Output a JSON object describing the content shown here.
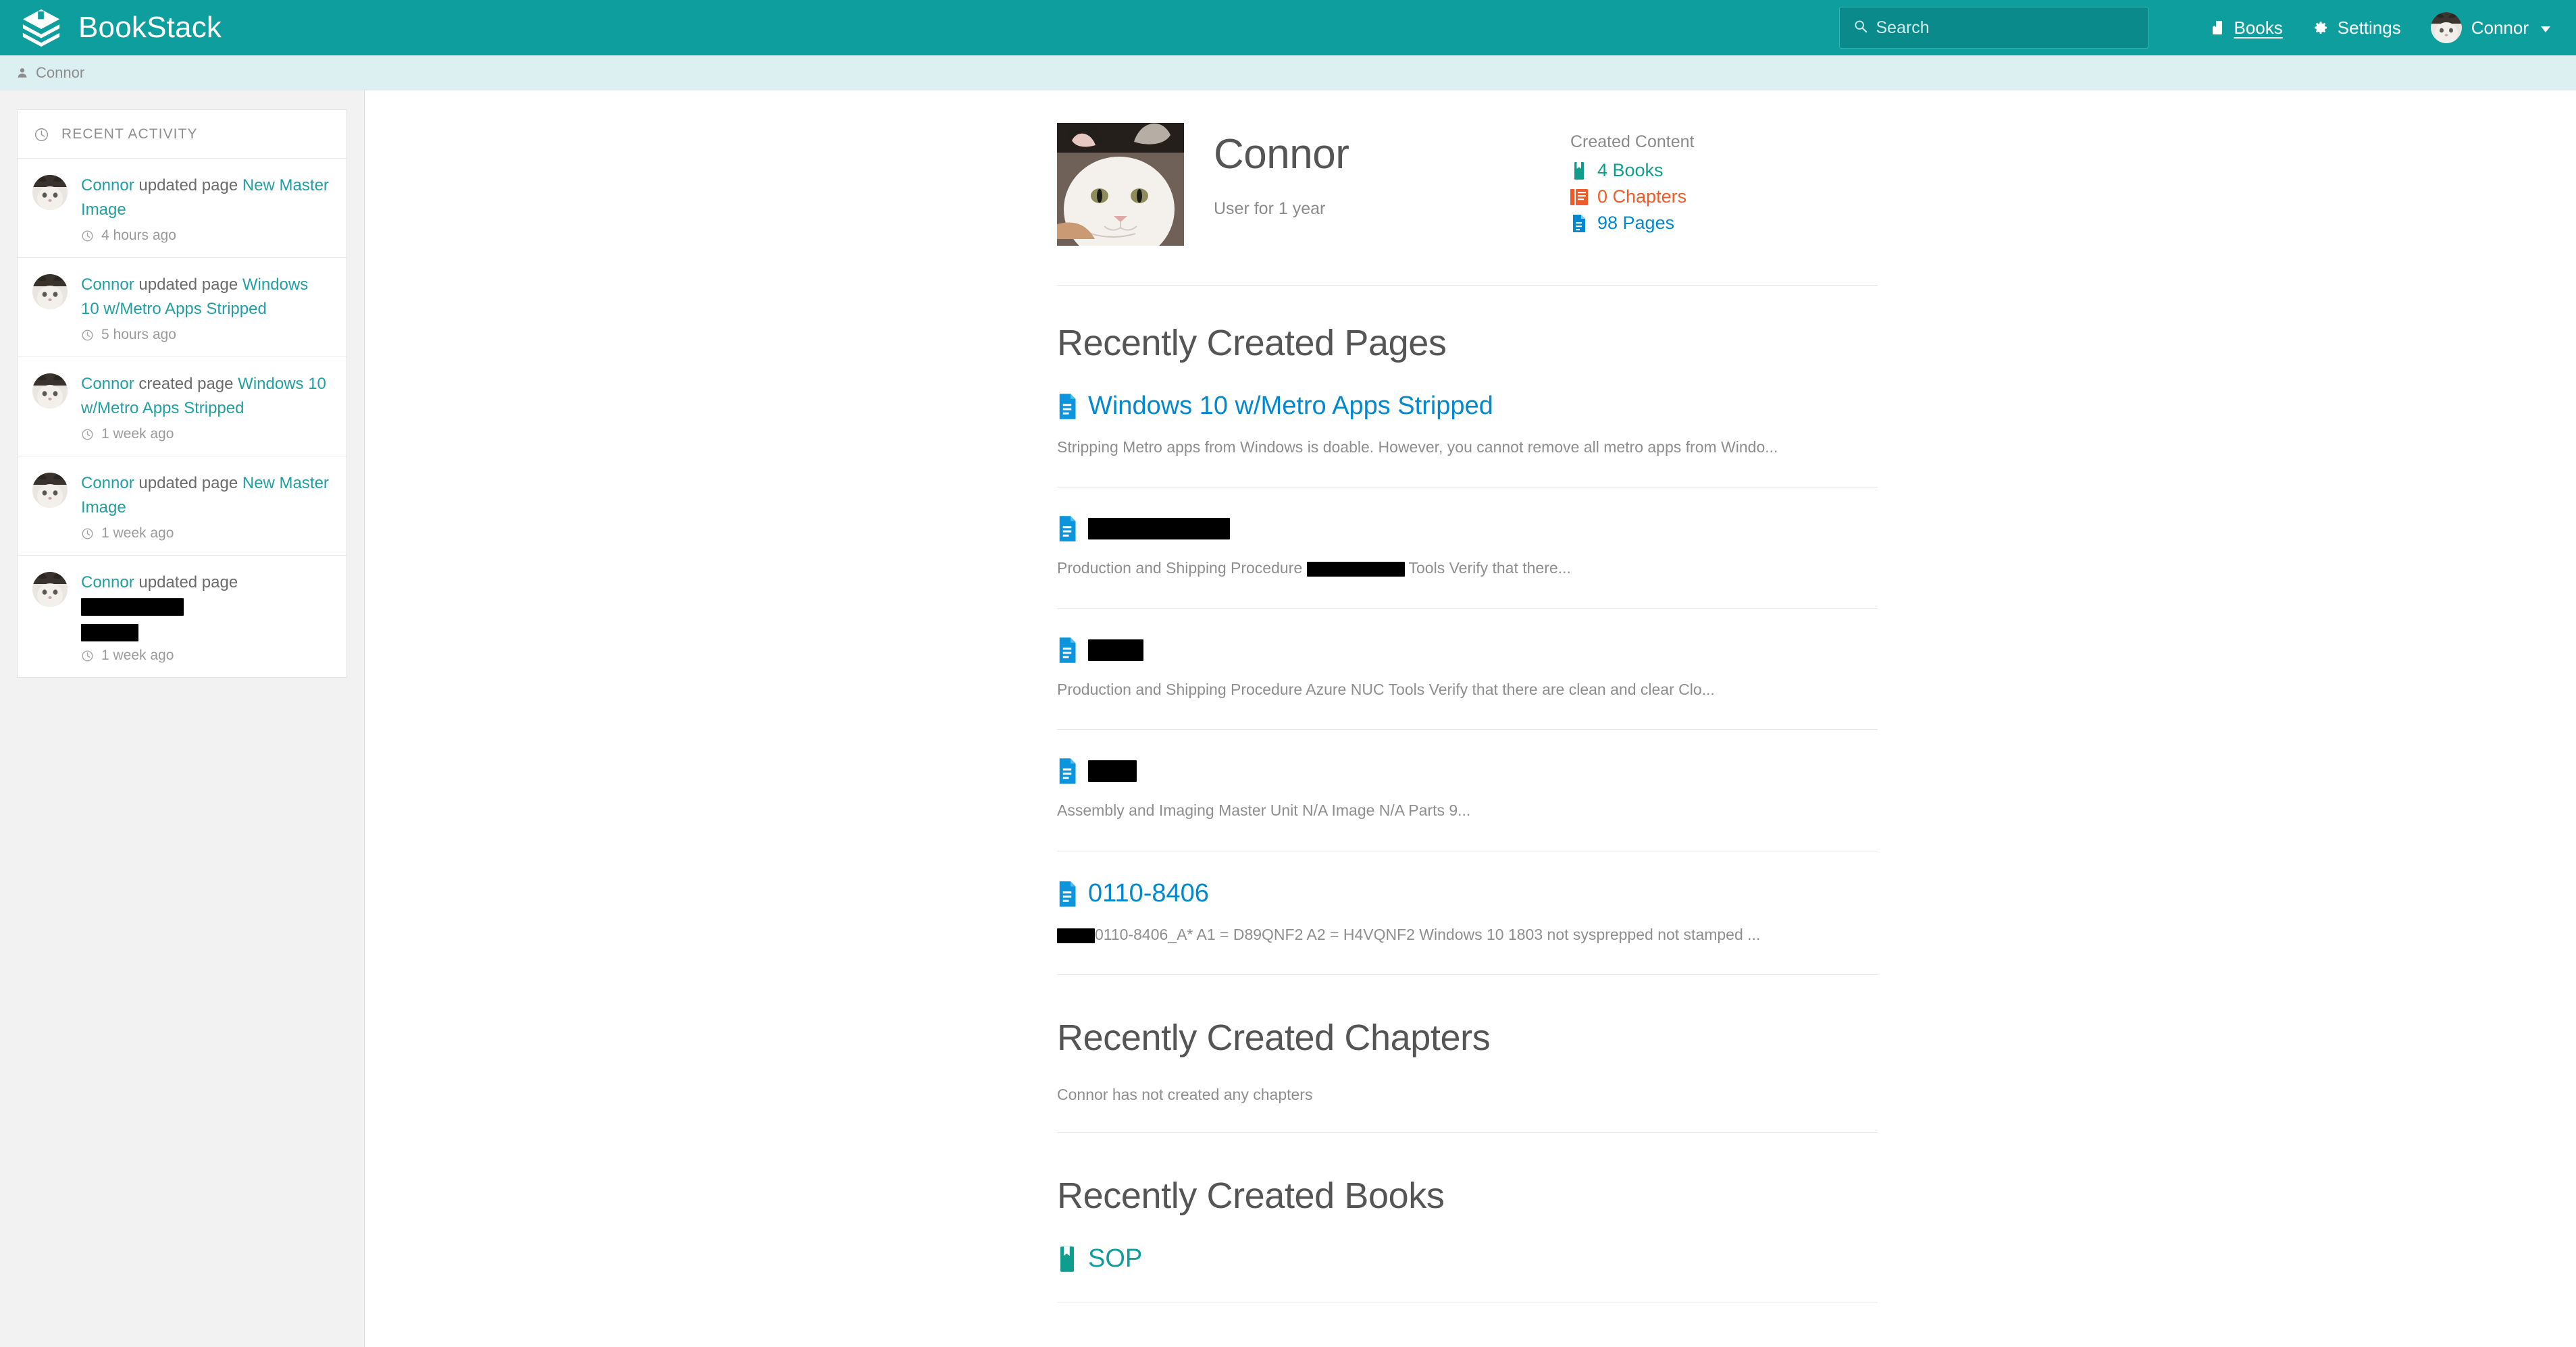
{
  "header": {
    "brand": "BookStack",
    "brand_icon": "bookstack-logo-icon",
    "search": {
      "placeholder": "Search",
      "value": "",
      "icon": "search-icon"
    },
    "books_link": {
      "label": "Books",
      "icon": "book-icon"
    },
    "settings_link": {
      "label": "Settings",
      "icon": "gear-icon"
    },
    "user_menu": {
      "label": "Connor",
      "icon": "chevron-down-icon",
      "avatar": "user-avatar"
    },
    "bg_color": "#0f9e9e"
  },
  "breadcrumb": {
    "icon": "user-icon",
    "label": "Connor"
  },
  "sidebar": {
    "panel_title": "RECENT ACTIVITY",
    "panel_icon": "clock-icon",
    "items": [
      {
        "actor": "Connor",
        "action": "updated page",
        "target": "New Master Image",
        "target_redacted": false,
        "time": "4 hours ago"
      },
      {
        "actor": "Connor",
        "action": "updated page",
        "target": "Windows 10 w/Metro Apps Stripped",
        "target_redacted": false,
        "time": "5 hours ago"
      },
      {
        "actor": "Connor",
        "action": "created page",
        "target": "Windows 10 w/Metro Apps Stripped",
        "target_redacted": false,
        "time": "1 week ago"
      },
      {
        "actor": "Connor",
        "action": "updated page",
        "target": "New Master Image",
        "target_redacted": false,
        "time": "1 week ago"
      },
      {
        "actor": "Connor",
        "action": "updated page",
        "target": "",
        "target_redacted": true,
        "time": "1 week ago"
      }
    ]
  },
  "profile": {
    "name": "Connor",
    "subtitle": "User for 1 year",
    "avatar": "profile-photo",
    "created_content": {
      "title": "Created Content",
      "stats": [
        {
          "label": "4 Books",
          "icon": "book-icon",
          "color": "#0f9e8e"
        },
        {
          "label": "0 Chapters",
          "icon": "chapter-icon",
          "color": "#ef5b28"
        },
        {
          "label": "98 Pages",
          "icon": "page-icon",
          "color": "#0288d1"
        }
      ]
    }
  },
  "sections": {
    "pages": {
      "title": "Recently Created Pages",
      "entries": [
        {
          "title": "Windows 10 w/Metro Apps Stripped",
          "title_redacted": false,
          "icon": "page-icon",
          "desc_before": "Stripping Metro apps from Windows is doable. However, you cannot remove all metro apps from Windo...",
          "desc_redacted_width": 0,
          "desc_after": ""
        },
        {
          "title": "",
          "title_redacted": true,
          "title_redact_width": 210,
          "icon": "page-icon",
          "desc_before": "Production and Shipping Procedure ",
          "desc_redacted_width": 145,
          "desc_after": " Tools Verify that there..."
        },
        {
          "title": "",
          "title_redacted": true,
          "title_redact_width": 82,
          "icon": "page-icon",
          "desc_before": "Production and Shipping Procedure Azure NUC Tools Verify that there are clean and clear Clo...",
          "desc_redacted_width": 0,
          "desc_after": ""
        },
        {
          "title": "",
          "title_redacted": true,
          "title_redact_width": 72,
          "icon": "page-icon",
          "desc_before": "Assembly and Imaging Master Unit N/A Image N/A Parts 9...",
          "desc_redacted_width": 0,
          "desc_after": ""
        },
        {
          "title": "0110-8406",
          "title_redacted": false,
          "icon": "page-icon",
          "desc_before": "",
          "desc_redacted_width": 56,
          "desc_after": "0110-8406_A* A1 = D89QNF2 A2 = H4VQNF2 Windows 10 1803 not sysprepped not stamped ..."
        }
      ]
    },
    "chapters": {
      "title": "Recently Created Chapters",
      "empty_note": "Connor has not created any chapters"
    },
    "books": {
      "title": "Recently Created Books",
      "entries": [
        {
          "title": "SOP",
          "icon": "book-icon"
        }
      ]
    }
  }
}
